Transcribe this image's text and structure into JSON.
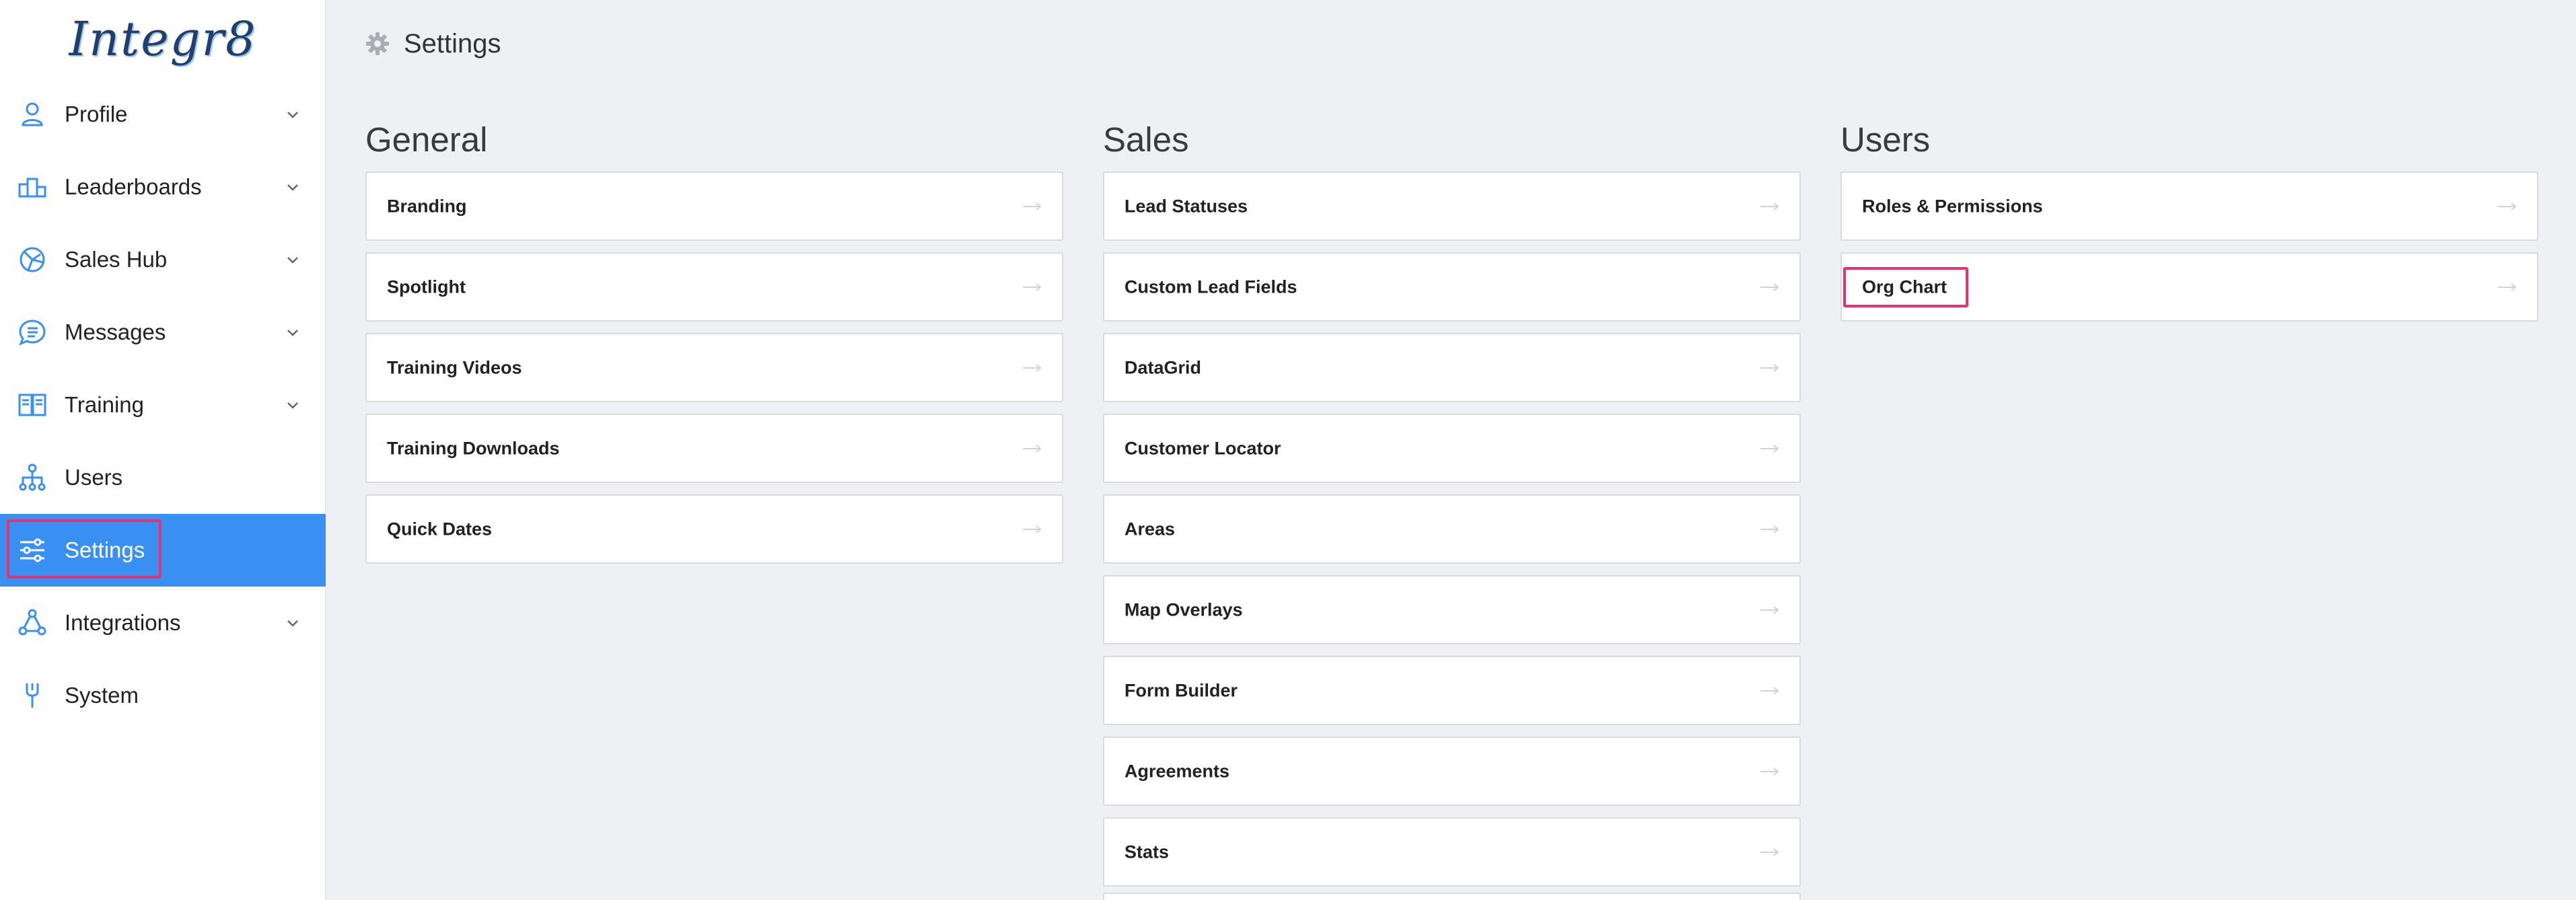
{
  "brand": {
    "logo_text": "Integr8"
  },
  "sidebar": {
    "items": [
      {
        "label": "Profile",
        "icon": "user-icon",
        "has_chevron": true
      },
      {
        "label": "Leaderboards",
        "icon": "leaderboard-icon",
        "has_chevron": true
      },
      {
        "label": "Sales Hub",
        "icon": "sales-hub-icon",
        "has_chevron": true
      },
      {
        "label": "Messages",
        "icon": "messages-icon",
        "has_chevron": true
      },
      {
        "label": "Training",
        "icon": "training-icon",
        "has_chevron": true
      },
      {
        "label": "Users",
        "icon": "org-users-icon",
        "has_chevron": false
      },
      {
        "label": "Settings",
        "icon": "sliders-icon",
        "has_chevron": false,
        "active": true
      },
      {
        "label": "Integrations",
        "icon": "integrations-icon",
        "has_chevron": true
      },
      {
        "label": "System",
        "icon": "wrench-icon",
        "has_chevron": false
      }
    ]
  },
  "header": {
    "title": "Settings",
    "icon": "gear-icon"
  },
  "sections": [
    {
      "title": "General",
      "items": [
        "Branding",
        "Spotlight",
        "Training Videos",
        "Training Downloads",
        "Quick Dates"
      ]
    },
    {
      "title": "Sales",
      "items": [
        "Lead Statuses",
        "Custom Lead Fields",
        "DataGrid",
        "Customer Locator",
        "Areas",
        "Map Overlays",
        "Form Builder",
        "Agreements",
        "Stats"
      ]
    },
    {
      "title": "Users",
      "items": [
        "Roles & Permissions",
        "Org Chart"
      ]
    }
  ],
  "colors": {
    "accent": "#3a8ff2",
    "highlight": "#e6336f",
    "background": "#eef0f3",
    "icon_blue": "#3a8ff2"
  }
}
